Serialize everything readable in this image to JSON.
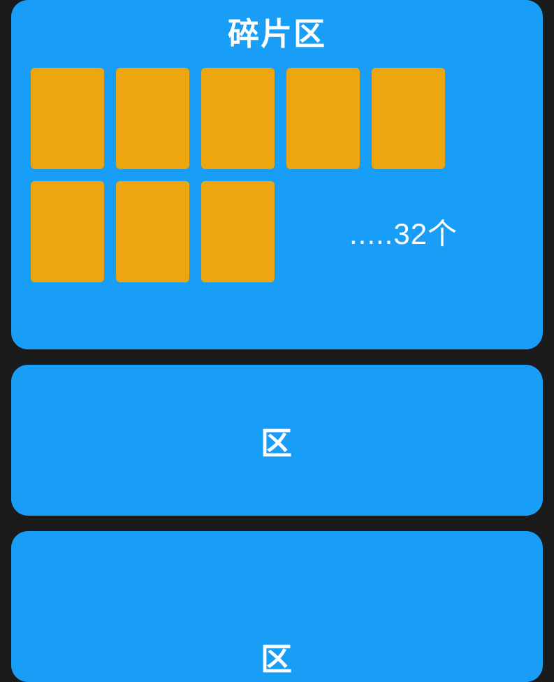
{
  "fragments": {
    "title": "碎片区",
    "card_count": 8,
    "count_label": ".....32个"
  },
  "zone1": {
    "title": "区"
  },
  "zone2": {
    "title": "区"
  },
  "colors": {
    "panel_bg": "#189ef7",
    "card_bg": "#eea610",
    "page_bg": "#1a1a1a",
    "text": "#ffffff"
  }
}
